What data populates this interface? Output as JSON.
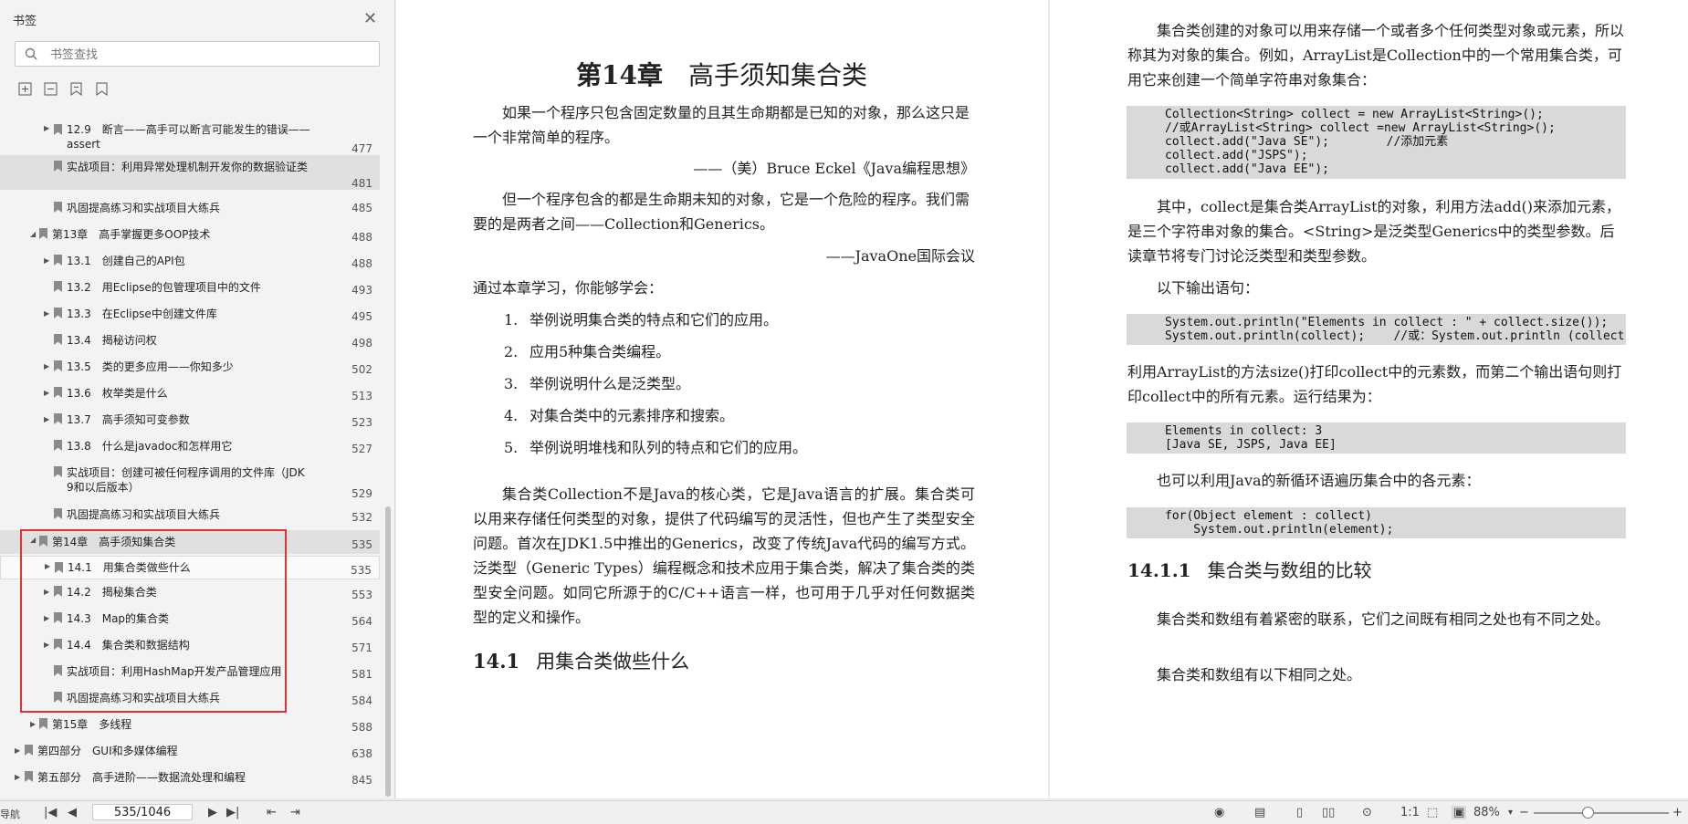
{
  "sidebar": {
    "title": "书签",
    "search_placeholder": "书签查找",
    "items": [
      {
        "label": "12.9　断言——高手可以断言可能发生的错误——assert",
        "page": "477"
      },
      {
        "label": "实战项目：利用异常处理机制开发你的数据验证类",
        "page": "481"
      },
      {
        "label": "巩固提高练习和实战项目大练兵",
        "page": "485"
      },
      {
        "label": "第13章　高手掌握更多OOP技术",
        "page": "488"
      },
      {
        "label": "13.1　创建自己的API包",
        "page": "488"
      },
      {
        "label": "13.2　用Eclipse的包管理项目中的文件",
        "page": "493"
      },
      {
        "label": "13.3　在Eclipse中创建文件库",
        "page": "495"
      },
      {
        "label": "13.4　揭秘访问权",
        "page": "498"
      },
      {
        "label": "13.5　类的更多应用——你知多少",
        "page": "502"
      },
      {
        "label": "13.6　枚举类是什么",
        "page": "513"
      },
      {
        "label": "13.7　高手须知可变参数",
        "page": "523"
      },
      {
        "label": "13.8　什么是javadoc和怎样用它",
        "page": "527"
      },
      {
        "label": "实战项目：创建可被任何程序调用的文件库（JDK 9和以后版本）",
        "page": "529"
      },
      {
        "label": "巩固提高练习和实战项目大练兵",
        "page": "532"
      },
      {
        "label": "第14章　高手须知集合类",
        "page": "535"
      },
      {
        "label": "14.1　用集合类做些什么",
        "page": "535"
      },
      {
        "label": "14.2　揭秘集合类",
        "page": "553"
      },
      {
        "label": "14.3　Map的集合类",
        "page": "564"
      },
      {
        "label": "14.4　集合类和数据结构",
        "page": "571"
      },
      {
        "label": "实战项目：利用HashMap开发产品管理应用",
        "page": "581"
      },
      {
        "label": "巩固提高练习和实战项目大练兵",
        "page": "584"
      },
      {
        "label": "第15章　多线程",
        "page": "588"
      },
      {
        "label": "第四部分　GUI和多媒体编程",
        "page": "638"
      },
      {
        "label": "第五部分　高手进阶——数据流处理和编程",
        "page": "845"
      }
    ]
  },
  "bottombar": {
    "nav_label": "导航",
    "page_indicator": "535/1046",
    "zoom": "88%"
  },
  "left_page": {
    "chapter_num": "第14章",
    "chapter_title": "高手须知集合类",
    "quote1": "如果一个程序只包含固定数量的且其生命期都是已知的对象，那么这只是一个非常简单的程序。",
    "quote1_src": "——（美）Bruce Eckel《Java编程思想》",
    "quote2": "但一个程序包含的都是生命期未知的对象，它是一个危险的程序。我们需要的是两者之间——Collection和Generics。",
    "quote2_src": "——JavaOne国际会议",
    "intro": "通过本章学习，你能够学会：",
    "goals": [
      "举例说明集合类的特点和它们的应用。",
      "应用5种集合类编程。",
      "举例说明什么是泛类型。",
      "对集合类中的元素排序和搜索。",
      "举例说明堆栈和队列的特点和它们的应用。"
    ],
    "paragraph": "集合类Collection不是Java的核心类，它是Java语言的扩展。集合类可以用来存储任何类型的对象，提供了代码编写的灵活性，但也产生了类型安全问题。首次在JDK1.5中推出的Generics，改变了传统Java代码的编写方式。泛类型（Generic Types）编程概念和技术应用于集合类，解决了集合类的类型安全问题。如同它所源于的C/C++语言一样，也可用于几乎对任何数据类型的定义和操作。",
    "section_num": "14.1",
    "section_title": "用集合类做些什么"
  },
  "right_page": {
    "p1": "集合类创建的对象可以用来存储一个或者多个任何类型对象或元素，所以称其为对象的集合。例如，ArrayList是Collection中的一个常用集合类，可用它来创建一个简单字符串对象集合：",
    "code1": "Collection<String> collect = new ArrayList<String>();\n//或ArrayList<String> collect =new ArrayList<String>();\ncollect.add(\"Java SE\");        //添加元素\ncollect.add(\"JSPS\");\ncollect.add(\"Java EE\");",
    "p2": "其中，collect是集合类ArrayList的对象，利用方法add()来添加元素，是三个字符串对象的集合。<String>是泛类型Generics中的类型参数。后读章节将专门讨论泛类型和类型参数。",
    "p3": "以下输出语句：",
    "code2": "System.out.println(\"Elements in collect : \" + collect.size());\nSystem.out.println(collect);    //或：System.out.println (collect.toString());",
    "p4": "利用ArrayList的方法size()打印collect中的元素数，而第二个输出语句则打印collect中的所有元素。运行结果为：",
    "code3": "Elements in collect: 3\n[Java SE, JSPS, Java EE]",
    "p5": "也可以利用Java的新循环语遍历集合中的各元素：",
    "code4": "for(Object element : collect)\n    System.out.println(element);",
    "h_num": "14.1.1",
    "h_title": "集合类与数组的比较",
    "p6": "集合类和数组有着紧密的联系，它们之间既有相同之处也有不同之处。",
    "p7": "集合类和数组有以下相同之处。"
  }
}
